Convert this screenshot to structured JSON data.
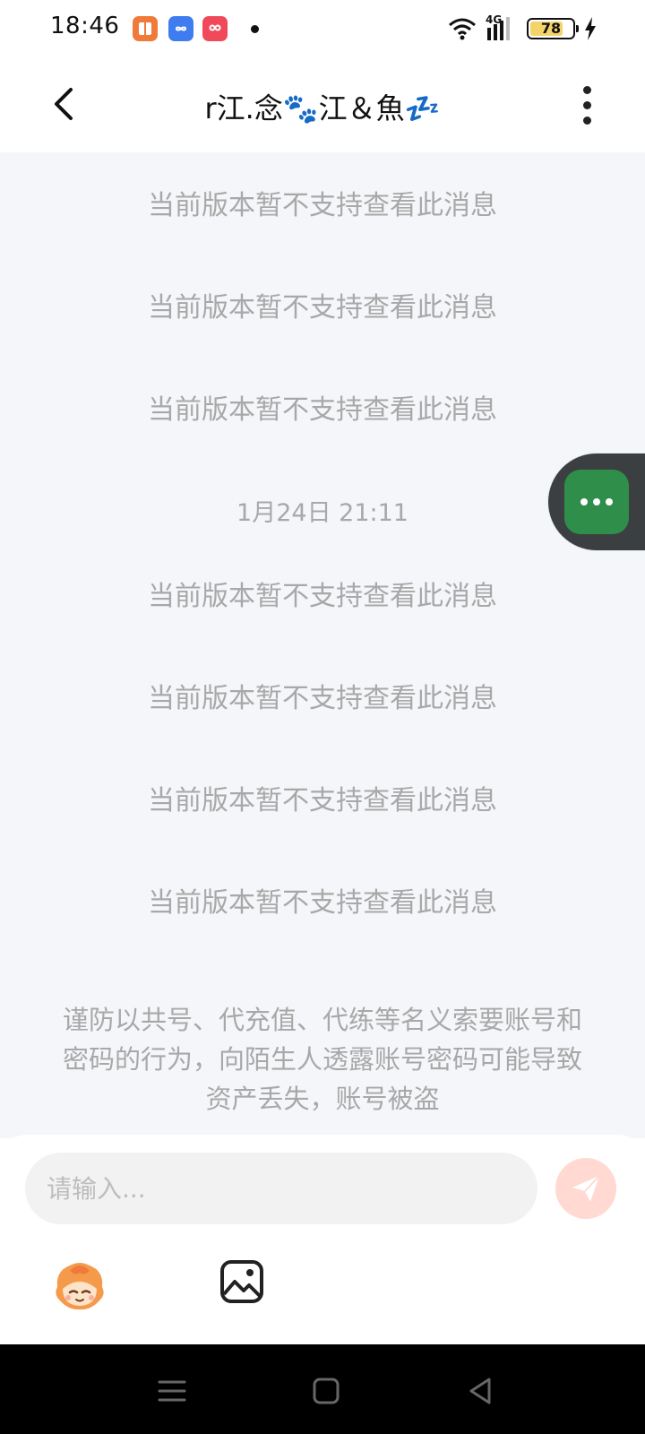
{
  "status_bar": {
    "time": "18:46",
    "network": "4G",
    "battery": "78",
    "battery_level": 0.78
  },
  "header": {
    "title": "r江.念🐾江＆魚💤"
  },
  "messages": [
    "当前版本暂不支持查看此消息",
    "当前版本暂不支持查看此消息",
    "当前版本暂不支持查看此消息",
    "当前版本暂不支持查看此消息",
    "当前版本暂不支持查看此消息",
    "当前版本暂不支持查看此消息",
    "当前版本暂不支持查看此消息"
  ],
  "timestamp": "1月24日 21:11",
  "warning": "谨防以共号、代充值、代练等名义索要账号和密码的行为，向陌生人透露账号密码可能导致资产丢失，账号被盗",
  "input": {
    "placeholder": "请输入..."
  },
  "icons": {
    "back": "chevron-left-icon",
    "more": "more-vertical-icon",
    "floating": "more-horizontal-icon",
    "send": "send-icon",
    "emoji": "emoji-sticker-icon",
    "image": "image-icon",
    "wifi": "wifi-icon",
    "signal": "signal-icon",
    "battery": "battery-icon",
    "charging": "lightning-icon"
  },
  "colors": {
    "chat_bg": "#f4f6f9",
    "system_text": "#a8a8a8",
    "send_button": "#ffd9d2",
    "float_button": "#2f8f4a"
  }
}
